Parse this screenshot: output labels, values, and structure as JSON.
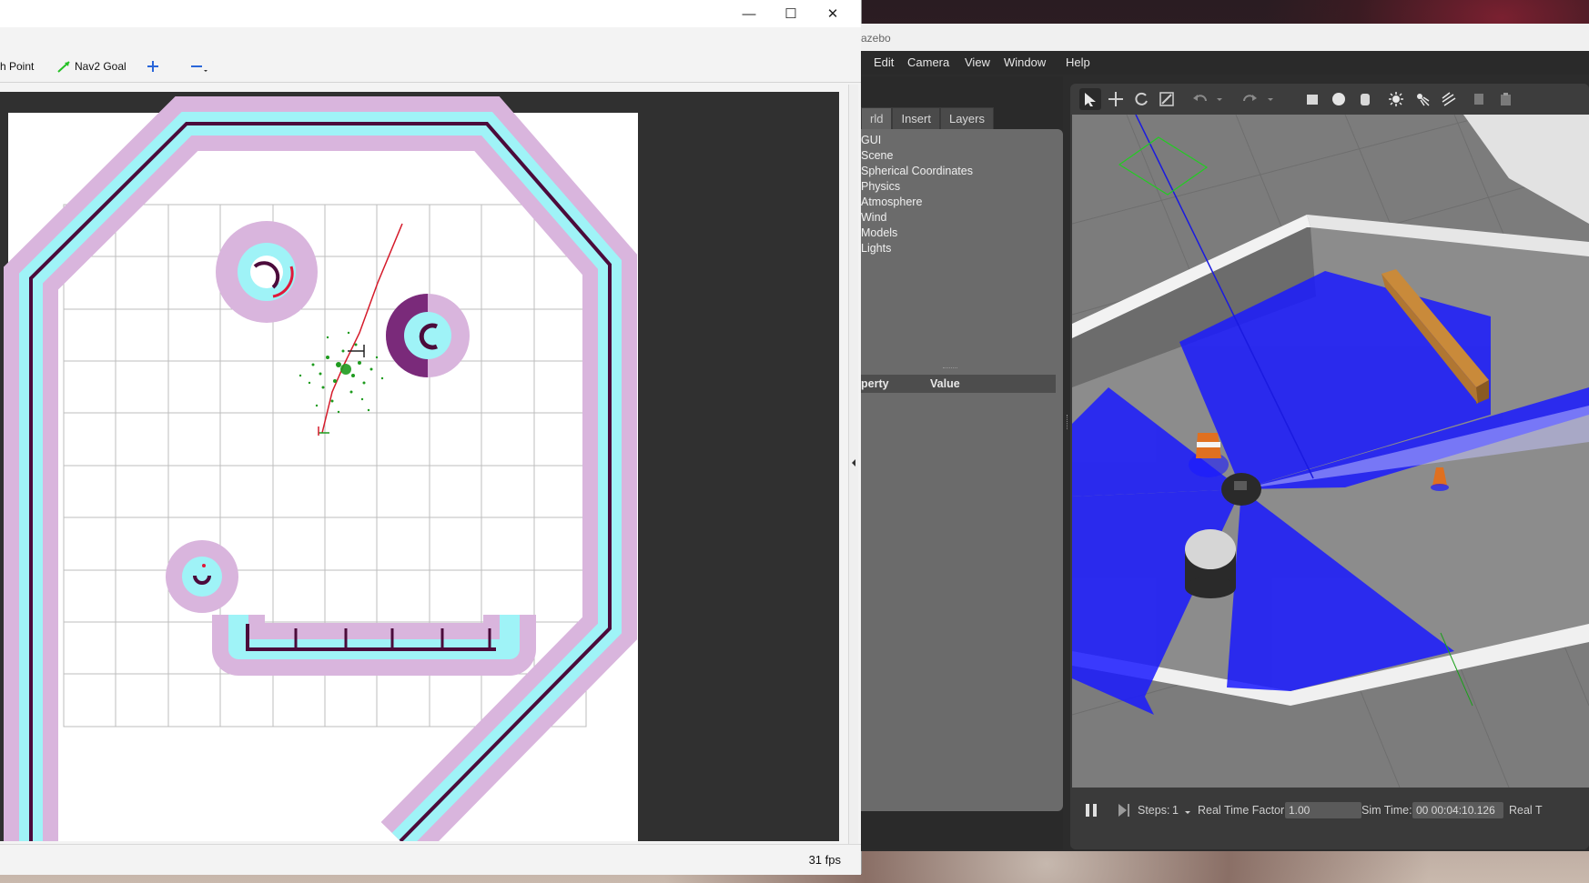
{
  "rviz": {
    "window_controls": {
      "minimize": "—",
      "maximize": "☐",
      "close": "✕"
    },
    "toolbar": {
      "publish_point_label": "h Point",
      "nav2_goal_label": "Nav2 Goal",
      "zoom_in_icon": "plus-icon",
      "zoom_out_icon": "minus-icon"
    },
    "status": {
      "fps": "31 fps"
    },
    "colors": {
      "viewport_bg": "#303030",
      "map_bg": "#ffffff",
      "inflation": "#d8b3dc",
      "cost": "#9ff3f7",
      "wall": "#4b0b3b"
    }
  },
  "gazebo": {
    "title": "azebo",
    "menu": [
      "Edit",
      "Camera",
      "View",
      "Window",
      "Help"
    ],
    "tabs": [
      "rld",
      "Insert",
      "Layers"
    ],
    "tree_items": [
      "GUI",
      "Scene",
      "Spherical Coordinates",
      "Physics",
      "Atmosphere",
      "Wind",
      "Models",
      "Lights"
    ],
    "property_header": {
      "property": "perty",
      "value": "Value"
    },
    "bottom": {
      "steps_label": "Steps:",
      "steps_value": "1",
      "rtf_label": "Real Time Factor:",
      "rtf_value": "1.00",
      "sim_time_label": "Sim Time:",
      "sim_time_value": "00 00:04:10.126",
      "real_label": "Real T"
    },
    "colors": {
      "laser": "#1a1aff",
      "floor": "#8c8c8c",
      "wall": "#f2f2f2",
      "box": "#c98a3a"
    }
  }
}
